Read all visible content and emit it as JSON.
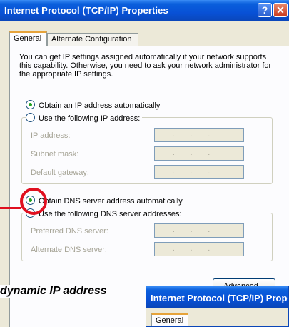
{
  "window": {
    "title": "Internet Protocol (TCP/IP) Properties",
    "help_glyph": "?",
    "close_glyph": "✕"
  },
  "tabs": [
    {
      "label": "General"
    },
    {
      "label": "Alternate Configuration"
    }
  ],
  "intro_text": "You can get IP settings assigned automatically if your network supports this capability. Otherwise, you need to ask your network administrator for the appropriate IP settings.",
  "ip": {
    "auto_label": "Obtain an IP address automatically",
    "manual_label": "Use the following IP address:",
    "fields": [
      {
        "label": "IP address:"
      },
      {
        "label": "Subnet mask:"
      },
      {
        "label": "Default gateway:"
      }
    ]
  },
  "dns": {
    "auto_label": "Obtain DNS server address automatically",
    "manual_label": "Use the following DNS server addresses:",
    "fields": [
      {
        "label": "Preferred DNS server:"
      },
      {
        "label": "Alternate DNS server:"
      }
    ]
  },
  "ip_placeholder": "...",
  "advanced_label": "Advanced...",
  "caption": "dynamic IP address",
  "second_window": {
    "title": "Internet Protocol (TCP/IP) Properties",
    "tab_label": "General"
  },
  "colors": {
    "title_blue": "#0851d6",
    "callout_red": "#e01020",
    "selected_green": "#21a121"
  }
}
